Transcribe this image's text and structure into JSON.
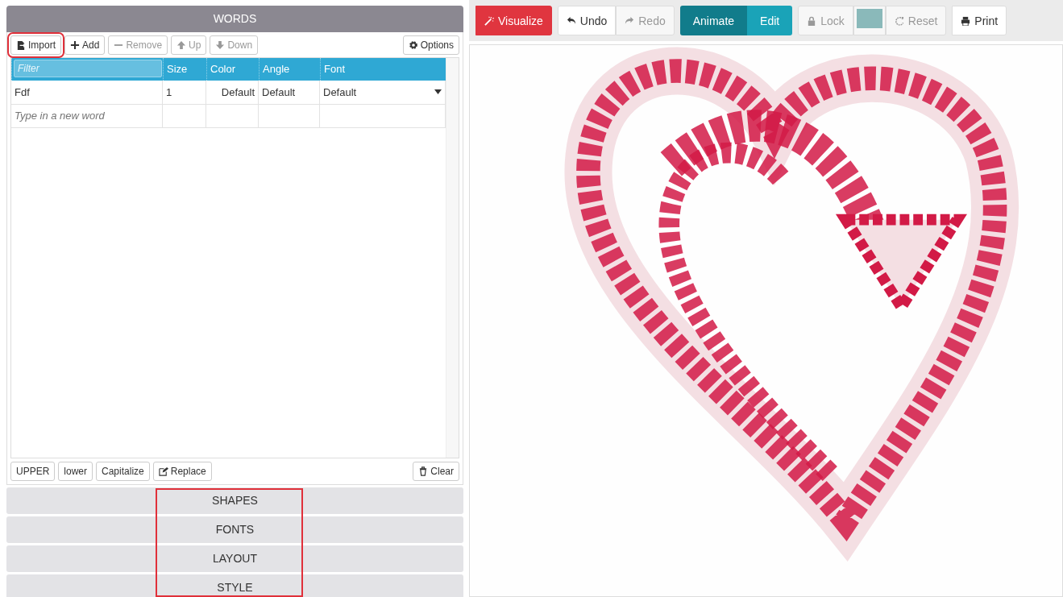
{
  "words_panel": {
    "title": "WORDS",
    "toolbar": [
      {
        "label": "Import",
        "disabled": false,
        "highlighted": true
      },
      {
        "label": "Add",
        "disabled": false,
        "highlighted": false
      },
      {
        "label": "Remove",
        "disabled": true,
        "highlighted": false
      },
      {
        "label": "Up",
        "disabled": true,
        "highlighted": false
      },
      {
        "label": "Down",
        "disabled": true,
        "highlighted": false
      }
    ],
    "options_button": {
      "label": "Options"
    },
    "table": {
      "columns": [
        {
          "placeholder": "Filter"
        },
        {
          "label": "Size"
        },
        {
          "label": "Color"
        },
        {
          "label": "Angle"
        },
        {
          "label": "Font"
        }
      ],
      "rows": [
        {
          "cells": [
            "Fdf",
            "1",
            "Default",
            "Default",
            "Default"
          ]
        }
      ],
      "new_word_placeholder": "Type in a new word"
    },
    "case_buttons": [
      "UPPER",
      "lower",
      "Capitalize",
      "Replace"
    ],
    "clear_button": {
      "label": "Clear"
    }
  },
  "sections": {
    "highlighted": true,
    "items": [
      "SHAPES",
      "FONTS",
      "LAYOUT",
      "STYLE"
    ]
  },
  "canvas_toolbar": [
    {
      "kind": "button",
      "label": "Visualize",
      "disabled": false
    },
    {
      "kind": "button",
      "label": "Undo",
      "disabled": false
    },
    {
      "kind": "button",
      "label": "Redo",
      "disabled": true
    },
    {
      "kind": "tab",
      "label": "Animate",
      "selected": true
    },
    {
      "kind": "tab",
      "label": "Edit",
      "selected": false
    },
    {
      "kind": "button",
      "label": "Lock",
      "disabled": true
    },
    {
      "kind": "swatch",
      "color": "#8ab9ba"
    },
    {
      "kind": "button",
      "label": "Reset",
      "disabled": true
    },
    {
      "kind": "button",
      "label": "Print",
      "disabled": false
    }
  ]
}
